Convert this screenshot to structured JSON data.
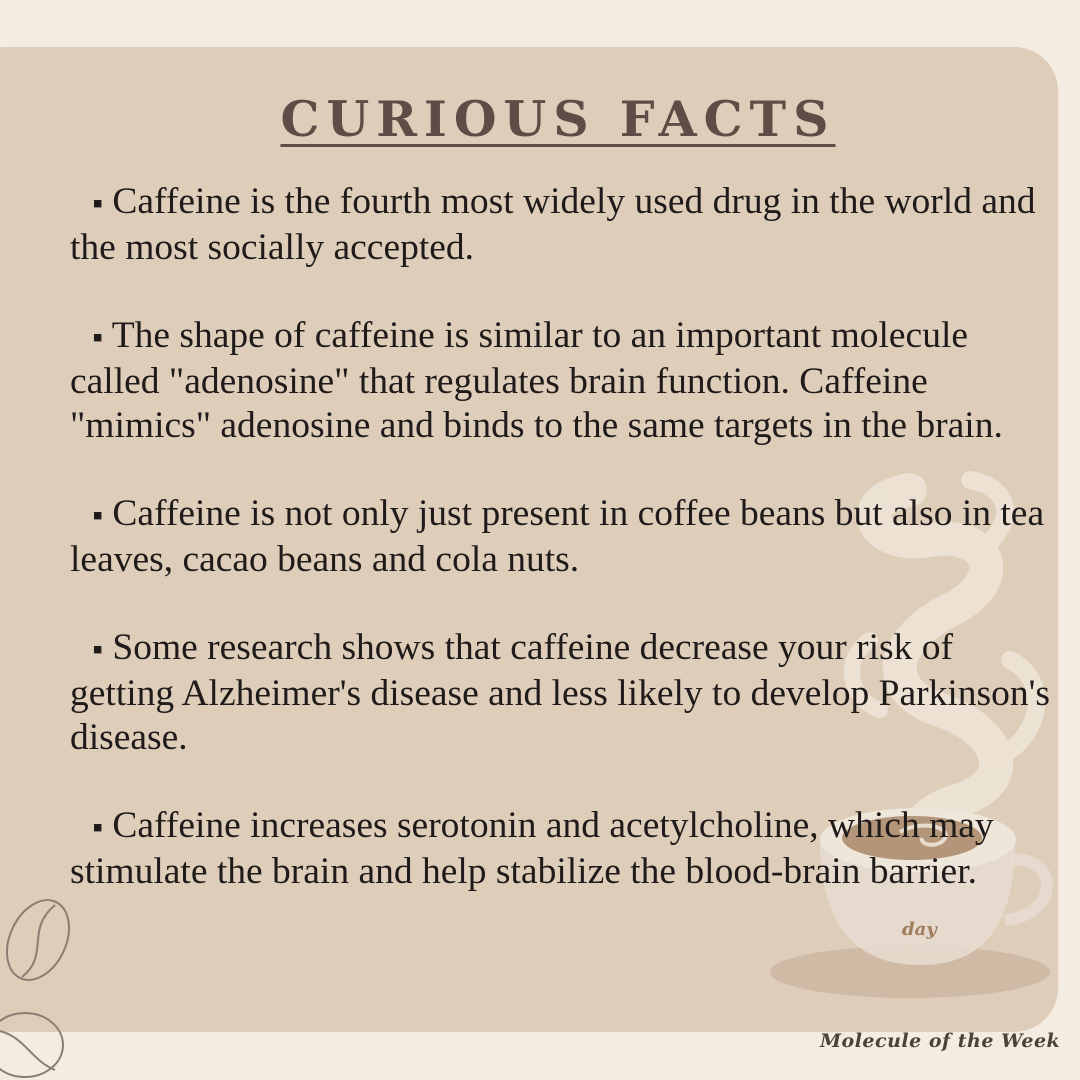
{
  "header": {
    "title": "CURIOUS FACTS"
  },
  "facts": [
    {
      "bullet": "▪",
      "text": "Caffeine is the fourth most widely used drug in the world and the most socially accepted."
    },
    {
      "bullet": "▪",
      "text": "The shape of caffeine is similar to an important molecule called \"adenosine\" that regulates brain function. Caffeine \"mimics\" adenosine and binds to the same targets in the brain."
    },
    {
      "bullet": "▪",
      "text": "Caffeine is not only just present in coffee beans but also in tea leaves, cacao beans and cola nuts."
    },
    {
      "bullet": "▪",
      "text": "Some research shows that caffeine decrease your risk of getting Alzheimer's disease and less likely to develop Parkinson's disease."
    },
    {
      "bullet": "▪",
      "text": "Caffeine increases serotonin and acetylcholine, which may stimulate the brain and help stabilize the blood-brain barrier."
    }
  ],
  "decor": {
    "cup_text": "day",
    "icons": [
      "coffee-cup-illustration",
      "coffee-bean-icon",
      "coffee-bean-icon"
    ]
  },
  "footer": {
    "signature": "Molecule of the Week"
  },
  "colors": {
    "background": "#f5ece1",
    "card": "#decdb9",
    "title": "#5e4d46",
    "text": "#1f1b1a"
  }
}
